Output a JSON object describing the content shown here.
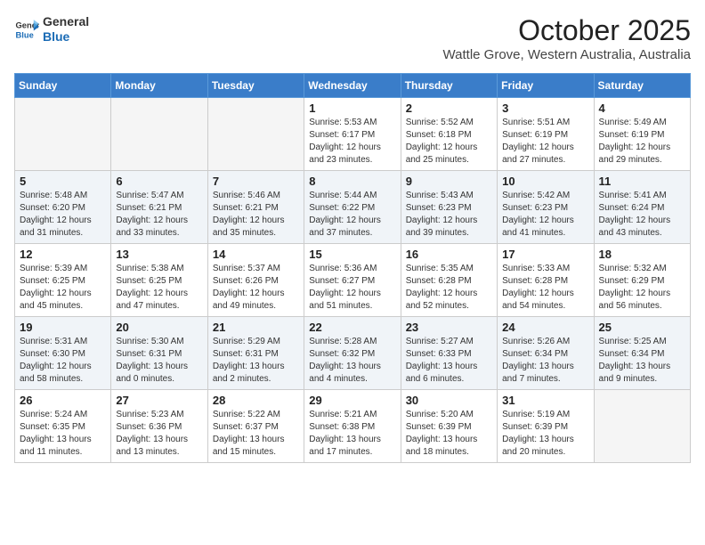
{
  "header": {
    "logo_line1": "General",
    "logo_line2": "Blue",
    "month": "October 2025",
    "location": "Wattle Grove, Western Australia, Australia"
  },
  "weekdays": [
    "Sunday",
    "Monday",
    "Tuesday",
    "Wednesday",
    "Thursday",
    "Friday",
    "Saturday"
  ],
  "weeks": [
    [
      {
        "day": "",
        "info": ""
      },
      {
        "day": "",
        "info": ""
      },
      {
        "day": "",
        "info": ""
      },
      {
        "day": "1",
        "info": "Sunrise: 5:53 AM\nSunset: 6:17 PM\nDaylight: 12 hours\nand 23 minutes."
      },
      {
        "day": "2",
        "info": "Sunrise: 5:52 AM\nSunset: 6:18 PM\nDaylight: 12 hours\nand 25 minutes."
      },
      {
        "day": "3",
        "info": "Sunrise: 5:51 AM\nSunset: 6:19 PM\nDaylight: 12 hours\nand 27 minutes."
      },
      {
        "day": "4",
        "info": "Sunrise: 5:49 AM\nSunset: 6:19 PM\nDaylight: 12 hours\nand 29 minutes."
      }
    ],
    [
      {
        "day": "5",
        "info": "Sunrise: 5:48 AM\nSunset: 6:20 PM\nDaylight: 12 hours\nand 31 minutes."
      },
      {
        "day": "6",
        "info": "Sunrise: 5:47 AM\nSunset: 6:21 PM\nDaylight: 12 hours\nand 33 minutes."
      },
      {
        "day": "7",
        "info": "Sunrise: 5:46 AM\nSunset: 6:21 PM\nDaylight: 12 hours\nand 35 minutes."
      },
      {
        "day": "8",
        "info": "Sunrise: 5:44 AM\nSunset: 6:22 PM\nDaylight: 12 hours\nand 37 minutes."
      },
      {
        "day": "9",
        "info": "Sunrise: 5:43 AM\nSunset: 6:23 PM\nDaylight: 12 hours\nand 39 minutes."
      },
      {
        "day": "10",
        "info": "Sunrise: 5:42 AM\nSunset: 6:23 PM\nDaylight: 12 hours\nand 41 minutes."
      },
      {
        "day": "11",
        "info": "Sunrise: 5:41 AM\nSunset: 6:24 PM\nDaylight: 12 hours\nand 43 minutes."
      }
    ],
    [
      {
        "day": "12",
        "info": "Sunrise: 5:39 AM\nSunset: 6:25 PM\nDaylight: 12 hours\nand 45 minutes."
      },
      {
        "day": "13",
        "info": "Sunrise: 5:38 AM\nSunset: 6:25 PM\nDaylight: 12 hours\nand 47 minutes."
      },
      {
        "day": "14",
        "info": "Sunrise: 5:37 AM\nSunset: 6:26 PM\nDaylight: 12 hours\nand 49 minutes."
      },
      {
        "day": "15",
        "info": "Sunrise: 5:36 AM\nSunset: 6:27 PM\nDaylight: 12 hours\nand 51 minutes."
      },
      {
        "day": "16",
        "info": "Sunrise: 5:35 AM\nSunset: 6:28 PM\nDaylight: 12 hours\nand 52 minutes."
      },
      {
        "day": "17",
        "info": "Sunrise: 5:33 AM\nSunset: 6:28 PM\nDaylight: 12 hours\nand 54 minutes."
      },
      {
        "day": "18",
        "info": "Sunrise: 5:32 AM\nSunset: 6:29 PM\nDaylight: 12 hours\nand 56 minutes."
      }
    ],
    [
      {
        "day": "19",
        "info": "Sunrise: 5:31 AM\nSunset: 6:30 PM\nDaylight: 12 hours\nand 58 minutes."
      },
      {
        "day": "20",
        "info": "Sunrise: 5:30 AM\nSunset: 6:31 PM\nDaylight: 13 hours\nand 0 minutes."
      },
      {
        "day": "21",
        "info": "Sunrise: 5:29 AM\nSunset: 6:31 PM\nDaylight: 13 hours\nand 2 minutes."
      },
      {
        "day": "22",
        "info": "Sunrise: 5:28 AM\nSunset: 6:32 PM\nDaylight: 13 hours\nand 4 minutes."
      },
      {
        "day": "23",
        "info": "Sunrise: 5:27 AM\nSunset: 6:33 PM\nDaylight: 13 hours\nand 6 minutes."
      },
      {
        "day": "24",
        "info": "Sunrise: 5:26 AM\nSunset: 6:34 PM\nDaylight: 13 hours\nand 7 minutes."
      },
      {
        "day": "25",
        "info": "Sunrise: 5:25 AM\nSunset: 6:34 PM\nDaylight: 13 hours\nand 9 minutes."
      }
    ],
    [
      {
        "day": "26",
        "info": "Sunrise: 5:24 AM\nSunset: 6:35 PM\nDaylight: 13 hours\nand 11 minutes."
      },
      {
        "day": "27",
        "info": "Sunrise: 5:23 AM\nSunset: 6:36 PM\nDaylight: 13 hours\nand 13 minutes."
      },
      {
        "day": "28",
        "info": "Sunrise: 5:22 AM\nSunset: 6:37 PM\nDaylight: 13 hours\nand 15 minutes."
      },
      {
        "day": "29",
        "info": "Sunrise: 5:21 AM\nSunset: 6:38 PM\nDaylight: 13 hours\nand 17 minutes."
      },
      {
        "day": "30",
        "info": "Sunrise: 5:20 AM\nSunset: 6:39 PM\nDaylight: 13 hours\nand 18 minutes."
      },
      {
        "day": "31",
        "info": "Sunrise: 5:19 AM\nSunset: 6:39 PM\nDaylight: 13 hours\nand 20 minutes."
      },
      {
        "day": "",
        "info": ""
      }
    ]
  ]
}
